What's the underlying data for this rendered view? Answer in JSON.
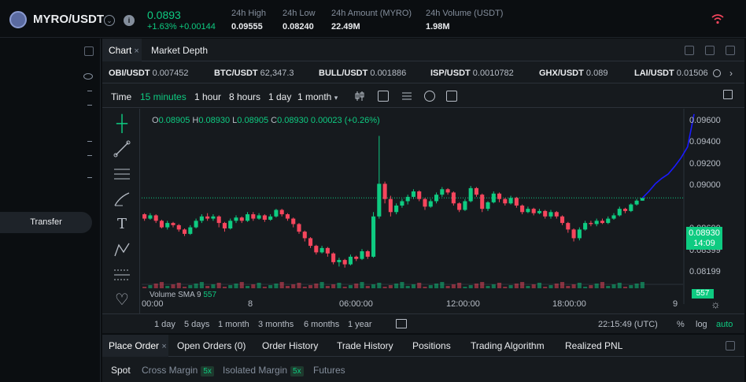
{
  "header": {
    "pair": "MYRO/USDT",
    "info_glyph": "i",
    "price": "0.0893",
    "change": "+1.63%  +0.00144",
    "stats": [
      {
        "label": "24h High",
        "value": "0.09555"
      },
      {
        "label": "24h Low",
        "value": "0.08240"
      },
      {
        "label": "24h Amount (MYRO)",
        "value": "22.49M"
      },
      {
        "label": "24h Volume (USDT)",
        "value": "1.98M"
      }
    ],
    "colors": {
      "up": "#0ecb81",
      "down": "#f6465d",
      "bg": "#0b0e11",
      "panel": "#161a1e",
      "line": "#1a1aff"
    }
  },
  "left": {
    "transfer_label": "Transfer"
  },
  "chart_tabs": [
    {
      "label": "Chart",
      "close": "×"
    },
    {
      "label": "Market Depth"
    }
  ],
  "tickers": [
    {
      "sym": "OBI/USDT",
      "price": "0.007452"
    },
    {
      "sym": "BTC/USDT",
      "price": "62,347.3"
    },
    {
      "sym": "BULL/USDT",
      "price": "0.001886"
    },
    {
      "sym": "ISP/USDT",
      "price": "0.0010782"
    },
    {
      "sym": "GHX/USDT",
      "price": "0.089"
    },
    {
      "sym": "LAI/USDT",
      "price": "0.01506"
    }
  ],
  "toolbar": {
    "time": "Time",
    "m15": "15 minutes",
    "h1": "1 hour",
    "h8": "8 hours",
    "d1": "1 day",
    "mo1": "1 month"
  },
  "ohlc": {
    "o_lbl": "O",
    "o": "0.08905",
    "h_lbl": "H",
    "h": "0.08930",
    "l_lbl": "L",
    "l": "0.08905",
    "c_lbl": "C",
    "c": "0.08930",
    "chg": "0.00023 (+0.26%)"
  },
  "volume": {
    "label": "Volume SMA 9",
    "value": "557"
  },
  "price_tag": {
    "price": "0.08930",
    "countdown": "14:09"
  },
  "chart_data": {
    "type": "candlestick",
    "yticks": [
      "0.09600",
      "0.09400",
      "0.09200",
      "0.09000",
      "0.08600",
      "0.08399",
      "0.08199"
    ],
    "xticks": [
      "00:00",
      "8",
      "06:00:00",
      "12:00:00",
      "18:00:00",
      "9"
    ],
    "ylim": [
      0.081,
      0.0975
    ],
    "last_price": 0.0893,
    "candles": [
      [
        0.0878,
        0.0874,
        0.0879,
        0.0872
      ],
      [
        0.0874,
        0.0877,
        0.0879,
        0.0873
      ],
      [
        0.0877,
        0.0872,
        0.0878,
        0.087
      ],
      [
        0.0872,
        0.0866,
        0.0873,
        0.0865
      ],
      [
        0.0866,
        0.087,
        0.0872,
        0.0864
      ],
      [
        0.087,
        0.0868,
        0.0871,
        0.0866
      ],
      [
        0.0868,
        0.0864,
        0.0869,
        0.0862
      ],
      [
        0.0864,
        0.086,
        0.0865,
        0.0858
      ],
      [
        0.086,
        0.0866,
        0.0868,
        0.0859
      ],
      [
        0.0866,
        0.0872,
        0.0874,
        0.0865
      ],
      [
        0.0872,
        0.0876,
        0.0878,
        0.087
      ],
      [
        0.0876,
        0.0874,
        0.0879,
        0.0872
      ],
      [
        0.0874,
        0.0876,
        0.0878,
        0.0872
      ],
      [
        0.0876,
        0.087,
        0.0877,
        0.0866
      ],
      [
        0.087,
        0.0865,
        0.0871,
        0.0862
      ],
      [
        0.0865,
        0.0872,
        0.0874,
        0.0864
      ],
      [
        0.0872,
        0.0875,
        0.0877,
        0.087
      ],
      [
        0.0875,
        0.0872,
        0.0876,
        0.087
      ],
      [
        0.0872,
        0.0878,
        0.088,
        0.0871
      ],
      [
        0.0878,
        0.0874,
        0.088,
        0.0872
      ],
      [
        0.0874,
        0.0877,
        0.0879,
        0.0873
      ],
      [
        0.0877,
        0.0873,
        0.0878,
        0.0871
      ],
      [
        0.0873,
        0.0876,
        0.0878,
        0.0872
      ],
      [
        0.0876,
        0.0882,
        0.0883,
        0.0875
      ],
      [
        0.0882,
        0.0878,
        0.0883,
        0.0876
      ],
      [
        0.0878,
        0.0874,
        0.0879,
        0.0872
      ],
      [
        0.0874,
        0.0869,
        0.0875,
        0.0866
      ],
      [
        0.0869,
        0.0862,
        0.087,
        0.086
      ],
      [
        0.0862,
        0.0856,
        0.0863,
        0.0853
      ],
      [
        0.0856,
        0.0849,
        0.0857,
        0.0847
      ],
      [
        0.0849,
        0.0843,
        0.085,
        0.0841
      ],
      [
        0.0843,
        0.0847,
        0.0849,
        0.0842
      ],
      [
        0.0847,
        0.0842,
        0.0848,
        0.0839
      ],
      [
        0.0842,
        0.0834,
        0.0843,
        0.0832
      ],
      [
        0.0834,
        0.0836,
        0.0838,
        0.083
      ],
      [
        0.0836,
        0.0832,
        0.0837,
        0.0829
      ],
      [
        0.0832,
        0.0839,
        0.0841,
        0.0831
      ],
      [
        0.0839,
        0.0837,
        0.084,
        0.0835
      ],
      [
        0.0837,
        0.0844,
        0.0846,
        0.0836
      ],
      [
        0.0844,
        0.0839,
        0.0845,
        0.0837
      ],
      [
        0.0839,
        0.0876,
        0.088,
        0.0838
      ],
      [
        0.0876,
        0.0906,
        0.095,
        0.0874
      ],
      [
        0.0906,
        0.0892,
        0.0908,
        0.0888
      ],
      [
        0.0892,
        0.088,
        0.0895,
        0.0876
      ],
      [
        0.088,
        0.0886,
        0.0888,
        0.0878
      ],
      [
        0.0886,
        0.089,
        0.0892,
        0.0884
      ],
      [
        0.089,
        0.0894,
        0.0896,
        0.0887
      ],
      [
        0.0894,
        0.0899,
        0.0901,
        0.0892
      ],
      [
        0.0899,
        0.0892,
        0.09,
        0.089
      ],
      [
        0.0892,
        0.0885,
        0.0893,
        0.0882
      ],
      [
        0.0885,
        0.089,
        0.0892,
        0.0884
      ],
      [
        0.089,
        0.0896,
        0.0898,
        0.0888
      ],
      [
        0.0896,
        0.0901,
        0.0903,
        0.0894
      ],
      [
        0.0901,
        0.0898,
        0.0902,
        0.0896
      ],
      [
        0.0898,
        0.0888,
        0.0899,
        0.0886
      ],
      [
        0.0888,
        0.0882,
        0.0889,
        0.088
      ],
      [
        0.0882,
        0.089,
        0.0892,
        0.0881
      ],
      [
        0.089,
        0.0902,
        0.0904,
        0.0889
      ],
      [
        0.0902,
        0.0896,
        0.0903,
        0.0894
      ],
      [
        0.0896,
        0.0883,
        0.0897,
        0.088
      ],
      [
        0.0883,
        0.0889,
        0.089,
        0.0881
      ],
      [
        0.0889,
        0.0897,
        0.0899,
        0.0888
      ],
      [
        0.0897,
        0.0892,
        0.0898,
        0.0889
      ],
      [
        0.0892,
        0.0888,
        0.0893,
        0.0886
      ],
      [
        0.0888,
        0.0893,
        0.0895,
        0.0887
      ],
      [
        0.0893,
        0.0886,
        0.0894,
        0.0884
      ],
      [
        0.0886,
        0.088,
        0.0887,
        0.0878
      ],
      [
        0.088,
        0.0883,
        0.0885,
        0.0879
      ],
      [
        0.0883,
        0.0879,
        0.0884,
        0.0877
      ],
      [
        0.0879,
        0.0881,
        0.0883,
        0.0878
      ],
      [
        0.0881,
        0.0876,
        0.0882,
        0.0874
      ],
      [
        0.0876,
        0.088,
        0.0882,
        0.0874
      ],
      [
        0.088,
        0.0876,
        0.0881,
        0.0874
      ],
      [
        0.0876,
        0.087,
        0.0877,
        0.0868
      ],
      [
        0.087,
        0.0864,
        0.0871,
        0.0861
      ],
      [
        0.0864,
        0.0856,
        0.0865,
        0.0853
      ],
      [
        0.0856,
        0.0864,
        0.0866,
        0.0854
      ],
      [
        0.0864,
        0.087,
        0.0872,
        0.0863
      ],
      [
        0.087,
        0.0869,
        0.0872,
        0.0867
      ],
      [
        0.0869,
        0.0872,
        0.0874,
        0.0867
      ],
      [
        0.0872,
        0.087,
        0.0874,
        0.0869
      ],
      [
        0.087,
        0.0874,
        0.0876,
        0.0869
      ],
      [
        0.0874,
        0.0877,
        0.0879,
        0.0873
      ],
      [
        0.0877,
        0.0883,
        0.0885,
        0.0876
      ],
      [
        0.0883,
        0.0881,
        0.0884,
        0.0879
      ],
      [
        0.0881,
        0.0887,
        0.0888,
        0.088
      ],
      [
        0.0887,
        0.08905,
        0.0892,
        0.0886
      ],
      [
        0.08905,
        0.0893,
        0.0893,
        0.08905
      ]
    ],
    "ma_line": [
      0.0893,
      0.0899,
      0.0906,
      0.0911,
      0.0915,
      0.0922,
      0.093,
      0.094,
      0.097
    ]
  },
  "ranges": [
    "1 day",
    "5 days",
    "1 month",
    "3 months",
    "6 months",
    "1 year"
  ],
  "clock": "22:15:49 (UTC)",
  "axis_opts": {
    "pct": "%",
    "log": "log",
    "auto": "auto"
  },
  "bottom_tabs": [
    "Place Order",
    "Open Orders (0)",
    "Order History",
    "Trade History",
    "Positions",
    "Trading Algorithm",
    "Realized PNL"
  ],
  "bottom_close": "×",
  "modes": [
    {
      "label": "Spot"
    },
    {
      "label": "Cross Margin",
      "lev": "5x"
    },
    {
      "label": "Isolated Margin",
      "lev": "5x"
    },
    {
      "label": "Futures"
    }
  ]
}
